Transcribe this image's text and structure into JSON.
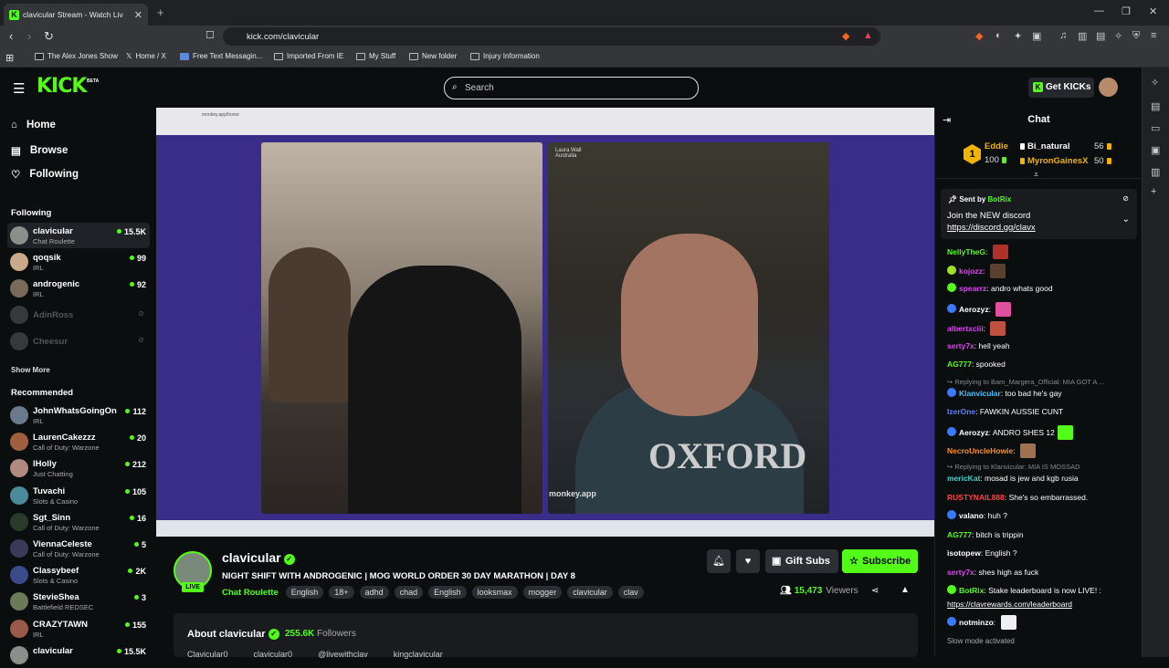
{
  "browser": {
    "tab_title": "clavicular Stream - Watch Liv",
    "url": "kick.com/clavicular",
    "bookmarks": [
      "The Alex Jones Show",
      "Home / X",
      "Free Text Messagin...",
      "Imported From IE",
      "My Stuff",
      "New folder",
      "Injury Information"
    ]
  },
  "header": {
    "logo": "KICK",
    "beta": "BETA",
    "search_placeholder": "Search",
    "get_kicks": "Get KICKs"
  },
  "sidebar": {
    "nav": [
      {
        "label": "Home",
        "icon": "home-icon"
      },
      {
        "label": "Browse",
        "icon": "browse-icon"
      },
      {
        "label": "Following",
        "icon": "heart-icon"
      }
    ],
    "following_heading": "Following",
    "following": [
      {
        "name": "clavicular",
        "category": "Chat Roulette",
        "viewers": "15.5K",
        "live": true,
        "color": "#8a8f8a"
      },
      {
        "name": "qoqsik",
        "category": "IRL",
        "viewers": "99",
        "live": true,
        "color": "#c9a98a"
      },
      {
        "name": "androgenic",
        "category": "IRL",
        "viewers": "92",
        "live": true,
        "color": "#7a6a5a"
      },
      {
        "name": "AdinRoss",
        "category": "",
        "viewers": "",
        "live": false,
        "color": "#777"
      },
      {
        "name": "Cheesur",
        "category": "",
        "viewers": "",
        "live": false,
        "color": "#777"
      }
    ],
    "show_more": "Show More",
    "recommended_heading": "Recommended",
    "recommended": [
      {
        "name": "JohnWhatsGoingOn",
        "category": "IRL",
        "viewers": "112",
        "color": "#6a7a8a"
      },
      {
        "name": "LaurenCakezzz",
        "category": "Call of Duty: Warzone",
        "viewers": "20",
        "color": "#a06040"
      },
      {
        "name": "lHolly",
        "category": "Just Chatting",
        "viewers": "212",
        "color": "#b08a80"
      },
      {
        "name": "Tuvachi",
        "category": "Slots & Casino",
        "viewers": "105",
        "color": "#4a8a9a"
      },
      {
        "name": "Sgt_Sinn",
        "category": "Call of Duty: Warzone",
        "viewers": "16",
        "color": "#2a3a2a"
      },
      {
        "name": "ViennaCeleste",
        "category": "Call of Duty: Warzone",
        "viewers": "5",
        "color": "#3a3a5a"
      },
      {
        "name": "Classybeef",
        "category": "Slots & Casino",
        "viewers": "2K",
        "color": "#3a4a8a"
      },
      {
        "name": "StevieShea",
        "category": "Battlefield REDSEC",
        "viewers": "3",
        "color": "#6a7a5a"
      },
      {
        "name": "CRAZYTAWN",
        "category": "IRL",
        "viewers": "155",
        "color": "#9a5a4a"
      },
      {
        "name": "clavicular",
        "category": "",
        "viewers": "15.5K",
        "color": "#8a8f8a"
      }
    ]
  },
  "video": {
    "left_cam_label": "Laura Wall",
    "left_cam_sub": "Australia",
    "overlay": "monkey.app",
    "shirt_text": "OXFORD"
  },
  "stream": {
    "channel": "clavicular",
    "live_label": "LIVE",
    "title": "NIGHT SHIFT WITH ANDROGENIC | MOG WORLD ORDER 30 DAY MARATHON | DAY 8",
    "category": "Chat Roulette",
    "tags": [
      "English",
      "18+",
      "adhd",
      "chad",
      "English",
      "looksmax",
      "mogger",
      "clavicular",
      "clav"
    ],
    "gift_subs": "Gift Subs",
    "subscribe": "Subscribe",
    "viewers": "15,473",
    "viewers_label": "Viewers",
    "about_title": "About clavicular",
    "followers": "255.6K",
    "followers_label": "Followers",
    "socials": [
      "Clavicular0",
      "clavicular0",
      "@livewithclav",
      "kingclavicular"
    ]
  },
  "chat": {
    "title": "Chat",
    "leaderboard": {
      "rank": "1",
      "top_name": "Eddie",
      "top_value": "100",
      "entries": [
        {
          "name": "Bi_natural",
          "value": "56",
          "color": "#ffffff"
        },
        {
          "name": "MyronGainesX",
          "value": "50",
          "color": "#f0b400"
        }
      ]
    },
    "pinned": {
      "sent_by": "Sent by",
      "bot": "BotRix",
      "line1": "Join the NEW discord",
      "line2": "https://discord.gg/clavx"
    },
    "messages": [
      {
        "user": "NellyTheG",
        "color": "#53fc18",
        "text": "",
        "emote": "#b0302a",
        "badge": ""
      },
      {
        "user": "kojozz",
        "color": "#e040fb",
        "text": "",
        "emote": "#5a4030",
        "badge": "#a0e020"
      },
      {
        "user": "spearrz",
        "color": "#e040fb",
        "text": "andro whats good",
        "emote": "",
        "badge": "#53fc18"
      },
      {
        "user": "Aerozyz",
        "color": "#ffffff",
        "text": "",
        "emote": "#e050a0",
        "badge": "#3a7aff"
      },
      {
        "user": "albertxciii",
        "color": "#e040fb",
        "text": "",
        "emote": "#c05040",
        "badge": ""
      },
      {
        "user": "serty7x",
        "color": "#e040fb",
        "text": "hell yeah",
        "emote": "",
        "badge": ""
      },
      {
        "user": "AG777",
        "color": "#53fc18",
        "text": "spooked",
        "emote": "",
        "badge": ""
      },
      {
        "reply": "Replying to Bam_Margera_Official: MIA GOT A ..."
      },
      {
        "user": "Klanvicular",
        "color": "#40c0ff",
        "text": "too bad he's gay",
        "emote": "",
        "badge": "#3a7aff"
      },
      {
        "user": "IzerOne",
        "color": "#6080ff",
        "text": "FAWKIN AUSSIE CUNT",
        "emote": "",
        "badge": ""
      },
      {
        "user": "Aerozyz",
        "color": "#ffffff",
        "text": "ANDRO SHES 12",
        "emote": "#53fc18",
        "badge": "#3a7aff"
      },
      {
        "user": "NecroUncleHowie",
        "color": "#ff9020",
        "text": "",
        "emote": "#a07050",
        "badge": ""
      },
      {
        "reply": "Replying to Klanvicular: MIA IS MOSSAD"
      },
      {
        "user": "mericKat",
        "color": "#40d0d0",
        "text": "mosad is jew and kgb rusia",
        "emote": "",
        "badge": ""
      },
      {
        "user": "RUSTYNAIL888",
        "color": "#ff4040",
        "text": "She's so embarrassed.",
        "emote": "",
        "badge": ""
      },
      {
        "user": "valano",
        "color": "#ffffff",
        "text": "huh ?",
        "emote": "",
        "badge": "#3a7aff"
      },
      {
        "user": "AG777",
        "color": "#53fc18",
        "text": "bitch is trippin",
        "emote": "",
        "badge": ""
      },
      {
        "user": "isotopew",
        "color": "#ffffff",
        "text": "English ?",
        "emote": "",
        "badge": ""
      },
      {
        "user": "serty7x",
        "color": "#e040fb",
        "text": "shes high as fuck",
        "emote": "",
        "badge": ""
      },
      {
        "user": "BotRix",
        "color": "#53fc18",
        "text": "Stake leaderboard is now LIVE! :",
        "emote": "",
        "badge": "#53fc18",
        "extra": "https://clavrewards.com/leaderboard"
      },
      {
        "user": "notminzo",
        "color": "#ffffff",
        "text": "",
        "emote": "#f0f0f0",
        "badge": "#3a7aff"
      }
    ],
    "slow_mode": "Slow mode activated"
  }
}
